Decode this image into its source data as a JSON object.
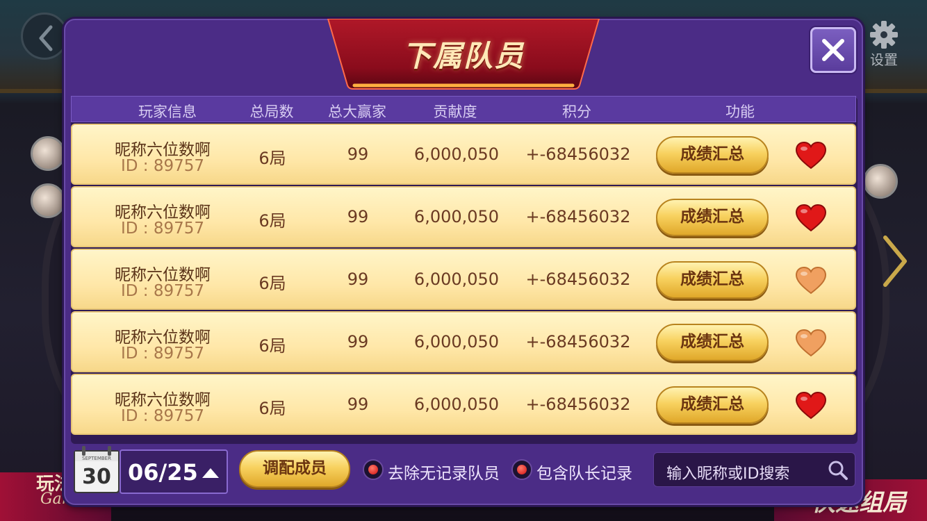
{
  "background": {
    "settings_label": "设置",
    "left_banner_text": "玩法",
    "left_banner_sub": "Gam",
    "right_banner_text": "快速组局"
  },
  "dialog": {
    "title": "下属队员",
    "columns": [
      "玩家信息",
      "总局数",
      "总大赢家",
      "贡献度",
      "积分",
      "功能"
    ],
    "rows": [
      {
        "name": "昵称六位数啊",
        "id": "ID : 89757",
        "games": "6局",
        "big_wins": "99",
        "contribution": "6,000,050",
        "score": "+-68456032",
        "button": "成绩汇总",
        "favorite": true
      },
      {
        "name": "昵称六位数啊",
        "id": "ID : 89757",
        "games": "6局",
        "big_wins": "99",
        "contribution": "6,000,050",
        "score": "+-68456032",
        "button": "成绩汇总",
        "favorite": true
      },
      {
        "name": "昵称六位数啊",
        "id": "ID : 89757",
        "games": "6局",
        "big_wins": "99",
        "contribution": "6,000,050",
        "score": "+-68456032",
        "button": "成绩汇总",
        "favorite": false
      },
      {
        "name": "昵称六位数啊",
        "id": "ID : 89757",
        "games": "6局",
        "big_wins": "99",
        "contribution": "6,000,050",
        "score": "+-68456032",
        "button": "成绩汇总",
        "favorite": false
      },
      {
        "name": "昵称六位数啊",
        "id": "ID : 89757",
        "games": "6局",
        "big_wins": "99",
        "contribution": "6,000,050",
        "score": "+-68456032",
        "button": "成绩汇总",
        "favorite": true
      }
    ],
    "footer": {
      "calendar_month": "SEPTEMBER",
      "calendar_day": "30",
      "date": "06/25",
      "assign_button": "调配成员",
      "option1": "去除无记录队员",
      "option2": "包含队长记录",
      "search_placeholder": "输入昵称或ID搜索"
    }
  },
  "colors": {
    "dialog_bg": "#4b2c86",
    "row_bg": "#ffe7a8",
    "heart_full": "#e01818",
    "heart_empty": "#f0a060",
    "button_gold": "#f8d260"
  }
}
